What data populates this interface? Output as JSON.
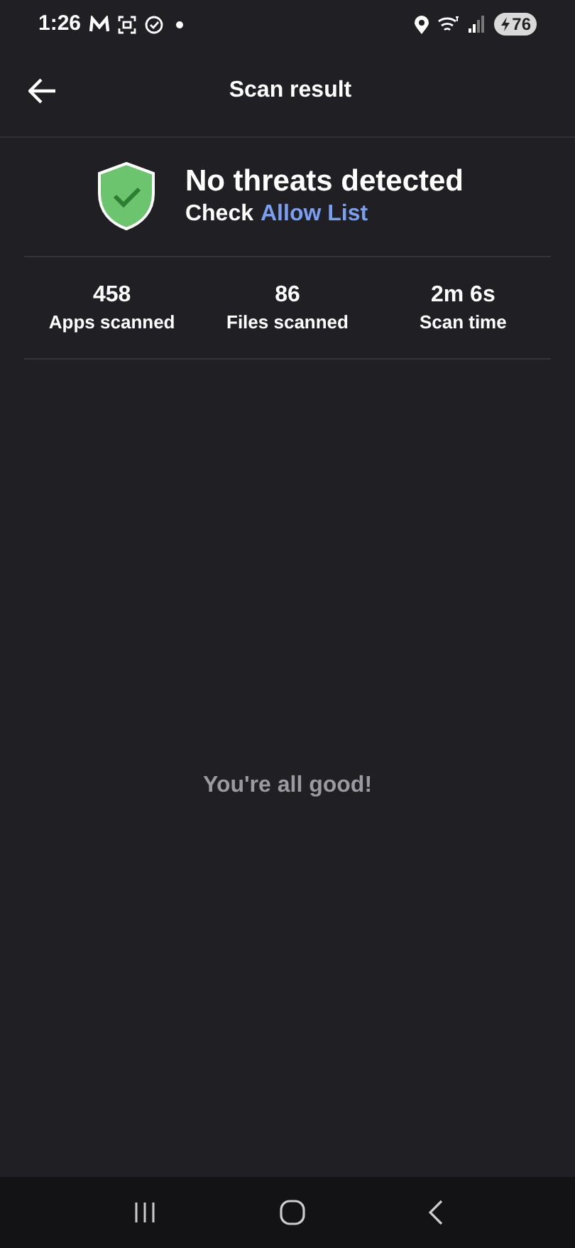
{
  "status_bar": {
    "time": "1:26",
    "battery": "76"
  },
  "header": {
    "title": "Scan result"
  },
  "result": {
    "title": "No threats detected",
    "subtitle_prefix": "Check",
    "link": "Allow List"
  },
  "stats": [
    {
      "value": "458",
      "label": "Apps scanned"
    },
    {
      "value": "86",
      "label": "Files scanned"
    },
    {
      "value": "2m 6s",
      "label": "Scan time"
    }
  ],
  "message": "You're all good!"
}
